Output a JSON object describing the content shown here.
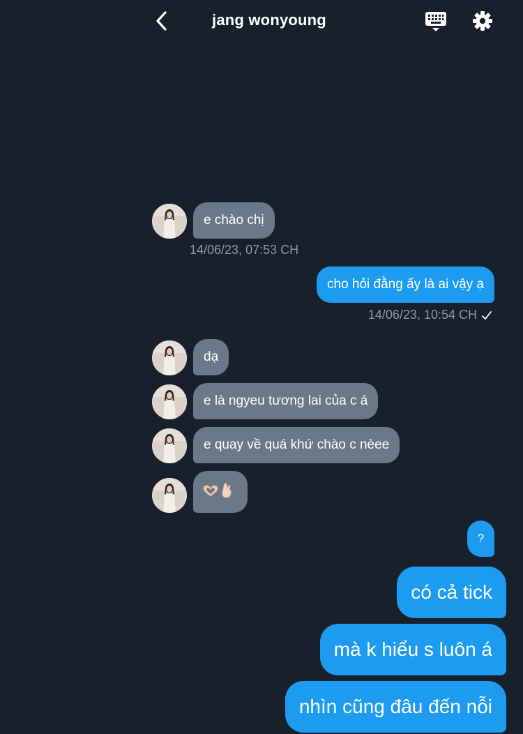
{
  "header": {
    "title": "jang wonyoung",
    "back_icon": "chevron-left-icon",
    "keyboard_icon": "keyboard-icon",
    "settings_icon": "gear-icon"
  },
  "messages": {
    "m1": {
      "text": "e chào chị",
      "timestamp": "14/06/23, 07:53 CH"
    },
    "m2": {
      "text": "cho hỏi đằng ấy là ai vậy ạ",
      "timestamp": "14/06/23, 10:54 CH",
      "status_icon": "checkmark-icon"
    },
    "m3": {
      "text": "dạ"
    },
    "m4": {
      "text": "e là ngyeu tương lai của c á"
    },
    "m5": {
      "text": "e quay về quá khứ chào c nèee"
    },
    "m6": {
      "emojis": [
        "heart-hands-emoji",
        "crossed-fingers-emoji"
      ]
    },
    "m7": {
      "text": "?"
    },
    "m8": {
      "text": "có cả tick"
    },
    "m9": {
      "text": "mà k hiểu s luôn á"
    },
    "m10": {
      "text": "nhìn cũng đâu đến nỗi"
    }
  },
  "colors": {
    "background": "#17202b",
    "received_bubble": "#6b7888",
    "sent_bubble": "#1d9bf0",
    "timestamp": "#8b98a5"
  }
}
